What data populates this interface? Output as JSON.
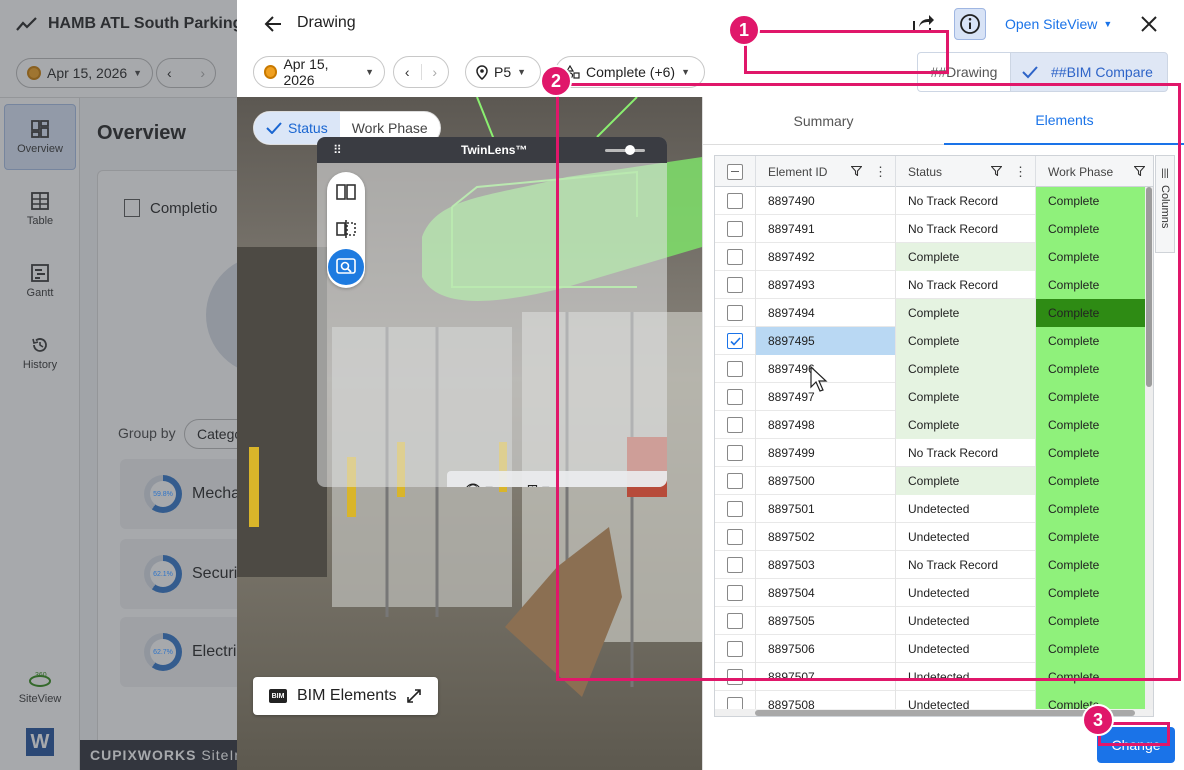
{
  "background": {
    "project_title": "HAMB ATL South Parking",
    "date": "Apr 15, 2026",
    "page_title": "Overview",
    "completion_label": "Completio",
    "group_by_label": "Group by",
    "group_by_value": "Catego",
    "rail": [
      {
        "label": "Overview",
        "icon": "overview-icon"
      },
      {
        "label": "Table",
        "icon": "table-icon"
      },
      {
        "label": "Gantt",
        "icon": "gantt-icon"
      },
      {
        "label": "History",
        "icon": "history-icon"
      },
      {
        "label": "SiteView",
        "icon": "siteview-icon"
      }
    ],
    "groups": [
      {
        "name": "Mecha",
        "pct": "59.8%"
      },
      {
        "name": "Securi",
        "pct": "62.1%"
      },
      {
        "name": "Electri",
        "pct": "62.7%"
      }
    ],
    "footer_brand": "CUPIXWORKS",
    "footer_rest": "SiteIns"
  },
  "dialog": {
    "title": "Drawing",
    "open_siteview": "Open SiteView",
    "date": "Apr 15, 2026",
    "level": "P5",
    "status_filter": "Complete (+6)",
    "view_tabs": {
      "drawing": "##Drawing",
      "bim_compare": "##BIM Compare"
    },
    "viewer": {
      "toggle": {
        "status": "Status",
        "work_phase": "Work Phase"
      },
      "twinlens_title": "TwinLens™",
      "bim_elements": "BIM Elements"
    },
    "panel": {
      "tabs": {
        "summary": "Summary",
        "elements": "Elements"
      },
      "columns": {
        "element_id": "Element ID",
        "status": "Status",
        "work_phase": "Work Phase",
        "side_tab": "Columns"
      },
      "rows": [
        {
          "id": "8897490",
          "status": "No Track Record",
          "phase": "Complete"
        },
        {
          "id": "8897491",
          "status": "No Track Record",
          "phase": "Complete"
        },
        {
          "id": "8897492",
          "status": "Complete",
          "phase": "Complete"
        },
        {
          "id": "8897493",
          "status": "No Track Record",
          "phase": "Complete"
        },
        {
          "id": "8897494",
          "status": "Complete",
          "phase": "Complete"
        },
        {
          "id": "8897495",
          "status": "Complete",
          "phase": "Complete",
          "selected": true
        },
        {
          "id": "8897496",
          "status": "Complete",
          "phase": "Complete"
        },
        {
          "id": "8897497",
          "status": "Complete",
          "phase": "Complete"
        },
        {
          "id": "8897498",
          "status": "Complete",
          "phase": "Complete"
        },
        {
          "id": "8897499",
          "status": "No Track Record",
          "phase": "Complete"
        },
        {
          "id": "8897500",
          "status": "Complete",
          "phase": "Complete"
        },
        {
          "id": "8897501",
          "status": "Undetected",
          "phase": "Complete"
        },
        {
          "id": "8897502",
          "status": "Undetected",
          "phase": "Complete"
        },
        {
          "id": "8897503",
          "status": "No Track Record",
          "phase": "Complete"
        },
        {
          "id": "8897504",
          "status": "Undetected",
          "phase": "Complete"
        },
        {
          "id": "8897505",
          "status": "Undetected",
          "phase": "Complete"
        },
        {
          "id": "8897506",
          "status": "Undetected",
          "phase": "Complete"
        },
        {
          "id": "8897507",
          "status": "Undetected",
          "phase": "Complete"
        },
        {
          "id": "8897508",
          "status": "Undetected",
          "phase": "Complete"
        }
      ],
      "change_button": "Change"
    }
  },
  "annotations": [
    "1",
    "2",
    "3"
  ],
  "colors": {
    "accent": "#1a73e8",
    "annotation": "#e0176a",
    "phase_complete": "#8ff17b",
    "phase_complete_dark": "#2e8b14",
    "status_complete_bg": "#e5f3e1"
  }
}
